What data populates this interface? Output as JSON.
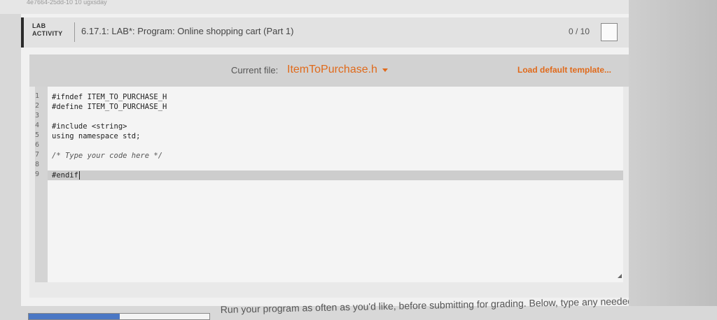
{
  "top_strip": {
    "id_text": "4e7664-25dd-10 10 ugxsday"
  },
  "header": {
    "lab_tag_line1": "LAB",
    "lab_tag_line2": "ACTIVITY",
    "title": "6.17.1: LAB*: Program: Online shopping cart (Part 1)",
    "score": "0 / 10"
  },
  "file_bar": {
    "current_file_label": "Current file:",
    "current_file_name": "ItemToPurchase.h",
    "load_template": "Load default template..."
  },
  "code": {
    "lines": [
      {
        "num": "1",
        "text": "#ifndef ITEM_TO_PURCHASE_H"
      },
      {
        "num": "2",
        "text": "#define ITEM_TO_PURCHASE_H"
      },
      {
        "num": "3",
        "text": ""
      },
      {
        "num": "4",
        "text": "#include <string>"
      },
      {
        "num": "5",
        "text": "using namespace std;"
      },
      {
        "num": "6",
        "text": ""
      },
      {
        "num": "7",
        "text": "/* Type your code here */"
      },
      {
        "num": "8",
        "text": ""
      },
      {
        "num": "9",
        "text": "#endif"
      }
    ]
  },
  "footer": {
    "instructions": "Run your program as often as you'd like, before submitting for grading. Below, type any needed"
  },
  "colors": {
    "accent": "#e06a1b"
  }
}
